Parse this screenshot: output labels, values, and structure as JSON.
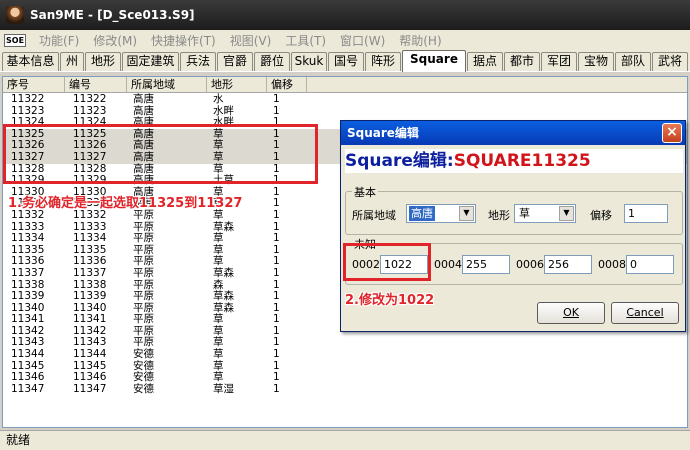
{
  "window": {
    "title": "San9ME - [D_Sce013.S9]"
  },
  "menubar": {
    "logo": "SOE",
    "items": [
      "功能(F)",
      "修改(M)",
      "快捷操作(T)",
      "视图(V)",
      "工具(T)",
      "窗口(W)",
      "帮助(H)"
    ]
  },
  "tabs": [
    "基本信息",
    "州",
    "地形",
    "固定建筑",
    "兵法",
    "官爵",
    "爵位",
    "Skuk",
    "国号",
    "阵形",
    "Square",
    "据点",
    "都市",
    "军团",
    "宝物",
    "部队",
    "武将"
  ],
  "active_tab": "Square",
  "table": {
    "columns": [
      "序号",
      "编号",
      "所属地域",
      "地形",
      "偏移"
    ],
    "rows": [
      [
        "11322",
        "11322",
        "高唐",
        "水",
        "1"
      ],
      [
        "11323",
        "11323",
        "高唐",
        "水畔",
        "1"
      ],
      [
        "11324",
        "11324",
        "高唐",
        "水畔",
        "1"
      ],
      [
        "11325",
        "11325",
        "高唐",
        "草",
        "1"
      ],
      [
        "11326",
        "11326",
        "高唐",
        "草",
        "1"
      ],
      [
        "11327",
        "11327",
        "高唐",
        "草",
        "1"
      ],
      [
        "11328",
        "11328",
        "高唐",
        "草",
        "1"
      ],
      [
        "11329",
        "11329",
        "高唐",
        "土草",
        "1"
      ],
      [
        "11330",
        "11330",
        "高唐",
        "草",
        "1"
      ],
      [
        "11331",
        "11331",
        "平原",
        "草",
        "1"
      ],
      [
        "11332",
        "11332",
        "平原",
        "草",
        "1"
      ],
      [
        "11333",
        "11333",
        "平原",
        "草森",
        "1"
      ],
      [
        "11334",
        "11334",
        "平原",
        "草",
        "1"
      ],
      [
        "11335",
        "11335",
        "平原",
        "草",
        "1"
      ],
      [
        "11336",
        "11336",
        "平原",
        "草",
        "1"
      ],
      [
        "11337",
        "11337",
        "平原",
        "草森",
        "1"
      ],
      [
        "11338",
        "11338",
        "平原",
        "森",
        "1"
      ],
      [
        "11339",
        "11339",
        "平原",
        "草森",
        "1"
      ],
      [
        "11340",
        "11340",
        "平原",
        "草森",
        "1"
      ],
      [
        "11341",
        "11341",
        "平原",
        "草",
        "1"
      ],
      [
        "11342",
        "11342",
        "平原",
        "草",
        "1"
      ],
      [
        "11343",
        "11343",
        "平原",
        "草",
        "1"
      ],
      [
        "11344",
        "11344",
        "安德",
        "草",
        "1"
      ],
      [
        "11345",
        "11345",
        "安德",
        "草",
        "1"
      ],
      [
        "11346",
        "11346",
        "安德",
        "草",
        "1"
      ],
      [
        "11347",
        "11347",
        "安德",
        "草湿",
        "1"
      ]
    ],
    "selected_rows": [
      "11325",
      "11326",
      "11327"
    ]
  },
  "annotations": {
    "step1": "1.务必确定是一起选取11325到11327",
    "step2": "2.修改为1022",
    "color": "#e0242a"
  },
  "dialog": {
    "title": "Square编辑",
    "heading_prefix": "Square编辑:",
    "heading_id": "SQUARE11325",
    "basic_group": "基本",
    "region_label": "所属地域",
    "region_value": "高唐",
    "terrain_label": "地形",
    "terrain_value": "草",
    "offset_label": "偏移",
    "offset_value": "1",
    "unknown_group": "未知",
    "fields": [
      {
        "label": "0002",
        "value": "1022"
      },
      {
        "label": "0004",
        "value": "255"
      },
      {
        "label": "0006",
        "value": "256"
      },
      {
        "label": "0008",
        "value": "0"
      }
    ],
    "ok_label": "OK",
    "cancel_label": "Cancel"
  },
  "status": {
    "text": "就绪"
  }
}
